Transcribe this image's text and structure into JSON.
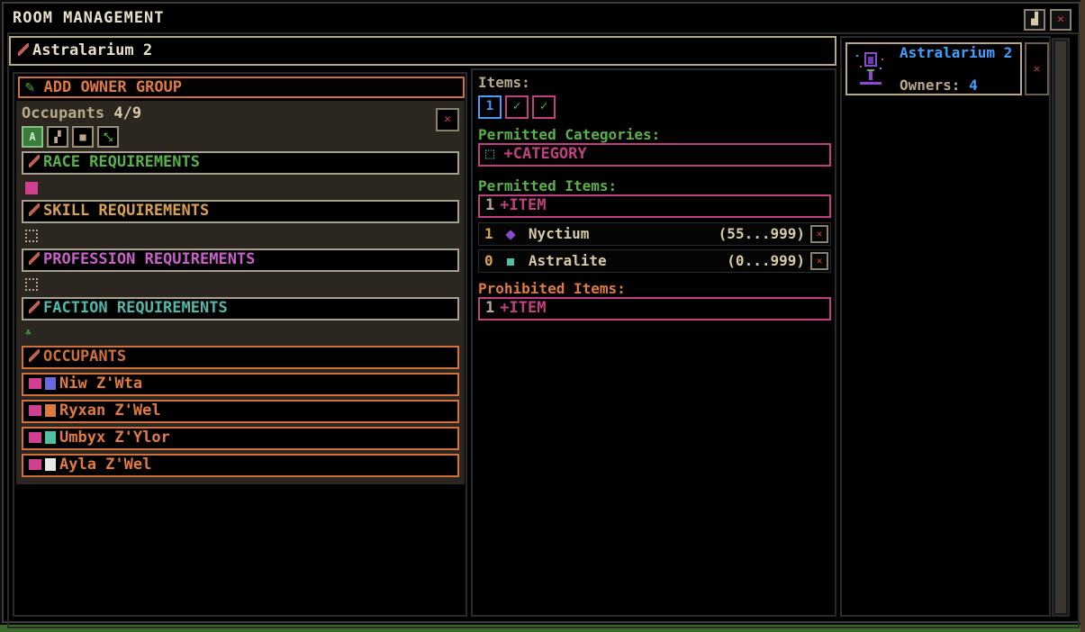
{
  "window": {
    "title": "ROOM MANAGEMENT",
    "minimize_icon": "minimize-icon",
    "close_icon": "close-icon"
  },
  "room_name": "Astralarium 2",
  "left": {
    "add_owner_group": "ADD OWNER GROUP",
    "occupants_label": "Occupants",
    "occupants_count": "4/9",
    "filter_icons": [
      "A",
      "▞",
      "■",
      "⤡"
    ],
    "race_requirements": "RACE REQUIREMENTS",
    "skill_requirements": "SKILL REQUIREMENTS",
    "profession_requirements": "PROFESSION REQUIREMENTS",
    "faction_requirements": "FACTION REQUIREMENTS",
    "occupants_section": "OCCUPANTS",
    "occupants": [
      {
        "name": "Niw Z'Wta",
        "race_color": "#6a6adf"
      },
      {
        "name": "Ryxan Z'Wel",
        "race_color": "#e07a40"
      },
      {
        "name": "Umbyx Z'Ylor",
        "race_color": "#50c0a0"
      },
      {
        "name": "Ayla Z'Wel",
        "race_color": "#e8e8e8"
      }
    ]
  },
  "middle": {
    "items_label": "Items:",
    "item_tabs": [
      "1",
      "✓",
      "✓"
    ],
    "permitted_categories_label": "Permitted Categories:",
    "add_category": "+CATEGORY",
    "permitted_items_label": "Permitted Items:",
    "add_item_permitted": "+ITEM",
    "add_item_count": "1",
    "items": [
      {
        "qty": "1",
        "name": "Nyctium",
        "range": "(55...999)",
        "color": "#8a4ad0"
      },
      {
        "qty": "0",
        "name": "Astralite",
        "range": "(0...999)",
        "color": "#50c0a0"
      }
    ],
    "prohibited_items_label": "Prohibited Items:",
    "add_item_prohibited": "+ITEM"
  },
  "right": {
    "room_card_name": "Astralarium 2",
    "owners_label": "Owners:",
    "owners_count": "4"
  },
  "colors": {
    "accent_orange": "#d0703c",
    "accent_pink": "#c04080",
    "accent_blue": "#40a0ff",
    "accent_green": "#5ab04a"
  }
}
